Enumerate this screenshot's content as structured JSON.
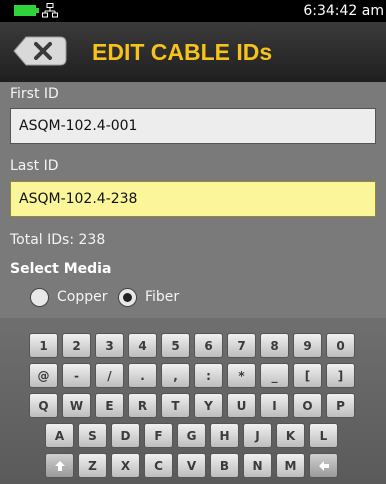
{
  "status": {
    "time": "6:34:42 am"
  },
  "header": {
    "title": "EDIT CABLE IDs",
    "back_icon": "close-x-icon",
    "accent": "#f7c31a"
  },
  "form": {
    "first_label": "First ID",
    "first_value": "ASQM-102.4-001",
    "last_label": "Last ID",
    "last_value": "ASQM-102.4-238",
    "total_text": "Total IDs: 238",
    "media_title": "Select Media",
    "media_options": [
      {
        "label": "Copper",
        "selected": false
      },
      {
        "label": "Fiber",
        "selected": true
      }
    ]
  },
  "keyboard": {
    "row1": [
      "1",
      "2",
      "3",
      "4",
      "5",
      "6",
      "7",
      "8",
      "9",
      "0"
    ],
    "row2": [
      "@",
      "-",
      "/",
      ".",
      ",",
      ":",
      "*",
      "_",
      "[",
      "]"
    ],
    "row3": [
      "Q",
      "W",
      "E",
      "R",
      "T",
      "Y",
      "U",
      "I",
      "O",
      "P"
    ],
    "row4": [
      "A",
      "S",
      "D",
      "F",
      "G",
      "H",
      "J",
      "K",
      "L"
    ],
    "row5": [
      "Z",
      "X",
      "C",
      "V",
      "B",
      "N",
      "M"
    ],
    "shift_icon": "shift-arrow-icon",
    "backspace_icon": "backspace-arrow-icon"
  }
}
